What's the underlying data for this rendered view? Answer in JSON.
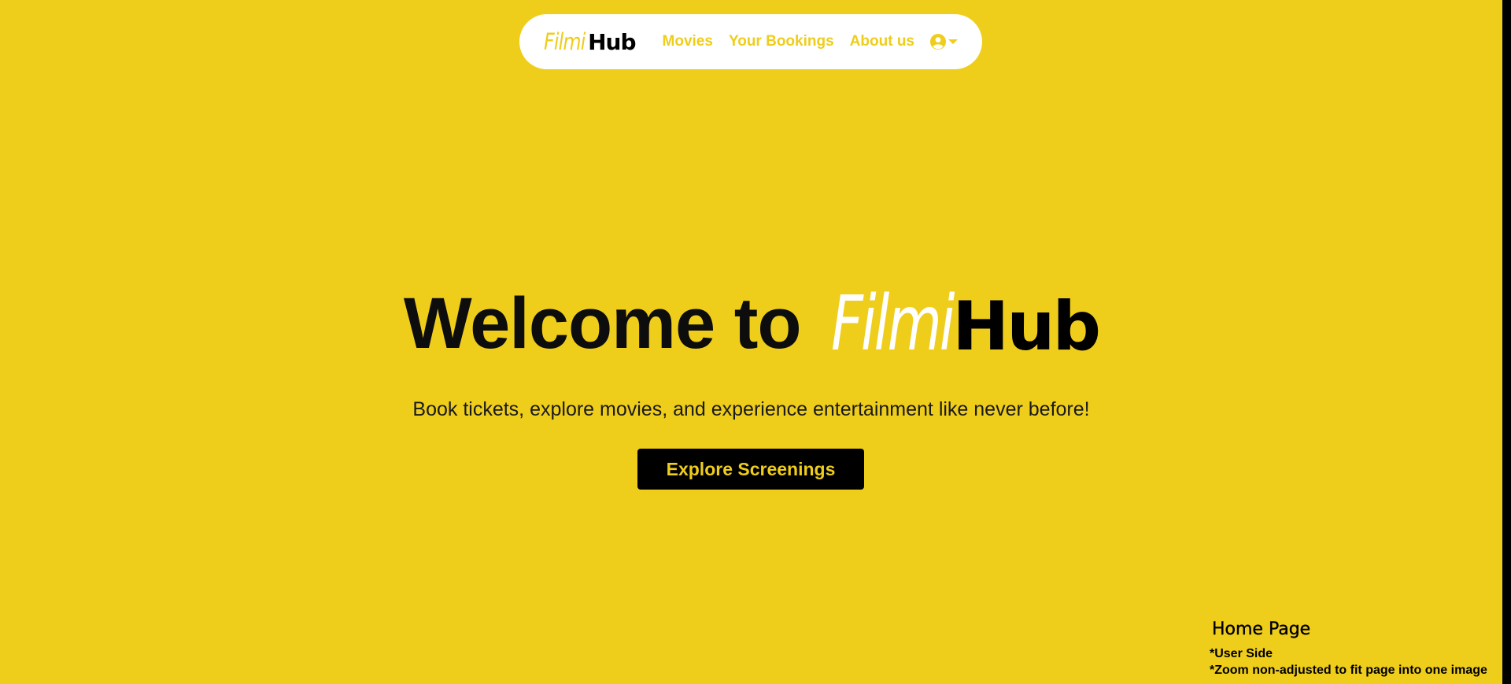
{
  "page": {
    "background": "#EFCD1B",
    "accent": "#EFCD1B"
  },
  "navbar": {
    "logo": {
      "part1": "Filmi",
      "part2": "Hub"
    },
    "links": [
      {
        "label": "Movies"
      },
      {
        "label": "Your Bookings"
      },
      {
        "label": "About us"
      }
    ],
    "user_icon": "user-circle-icon",
    "dropdown_icon": "caret-down-icon"
  },
  "hero": {
    "title_prefix": "Welcome to",
    "logo": {
      "part1": "Filmi",
      "part2": "Hub"
    },
    "subtitle": "Book tickets, explore movies, and experience entertainment like never before!",
    "cta_label": "Explore Screenings"
  },
  "caption": {
    "title": "Home Page",
    "notes": [
      "*User Side",
      "*Zoom non-adjusted to fit page into one image"
    ]
  }
}
